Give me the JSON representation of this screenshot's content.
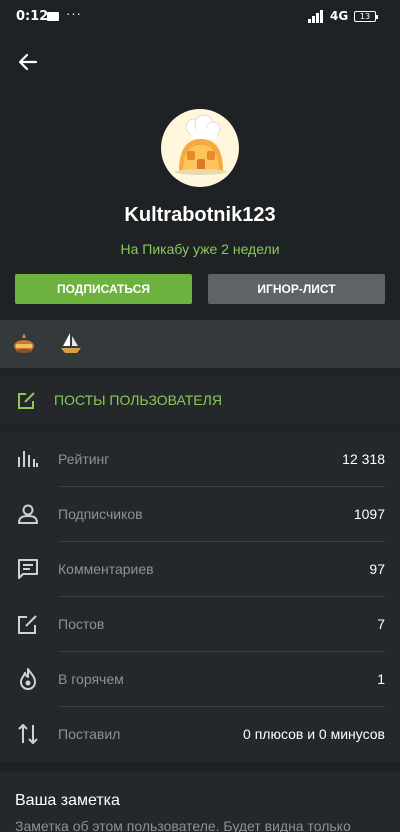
{
  "status_bar": {
    "time": "0:12",
    "more": "···",
    "network": "4G",
    "battery": "13"
  },
  "profile": {
    "username": "Kultrabotnik123",
    "since": "На Пикабу уже 2 недели",
    "subscribe_label": "ПОДПИСАТЬСЯ",
    "ignore_label": "ИГНОР-ЛИСТ"
  },
  "posts_link": {
    "label": "ПОСТЫ ПОЛЬЗОВАТЕЛЯ"
  },
  "stats": [
    {
      "label": "Рейтинг",
      "value": "12 318",
      "icon": "rating-icon"
    },
    {
      "label": "Подписчиков",
      "value": "1097",
      "icon": "person-icon"
    },
    {
      "label": "Комментариев",
      "value": "97",
      "icon": "comment-icon"
    },
    {
      "label": "Постов",
      "value": "7",
      "icon": "edit-icon"
    },
    {
      "label": "В горячем",
      "value": "1",
      "icon": "flame-icon"
    },
    {
      "label": "Поставил",
      "value": "0 плюсов и 0 минусов",
      "icon": "sort-arrows-icon"
    }
  ],
  "note": {
    "title": "Ваша заметка",
    "placeholder": "Заметка об этом пользователе. Будет видна только"
  },
  "colors": {
    "accent": "#6db23f",
    "accent_text": "#8ac858",
    "background": "#1f2224",
    "panel": "#24282a"
  }
}
